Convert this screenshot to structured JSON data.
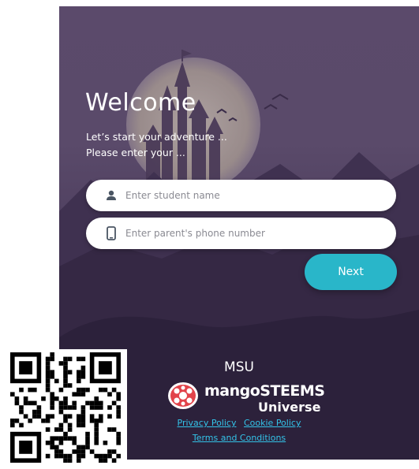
{
  "welcome": {
    "title": "Welcome",
    "subtitle_line1": "Let’s start your adventure ...",
    "subtitle_line2": "Please enter your ..."
  },
  "form": {
    "student_placeholder": "Enter student name",
    "phone_placeholder": "Enter parent's phone number",
    "next_label": "Next"
  },
  "footer": {
    "msu": "MSU",
    "logo_brand": "mangoSTEEMS",
    "logo_sub": "Universe",
    "privacy": "Privacy Policy",
    "cookie": "Cookie Policy",
    "terms": "Terms and Conditions"
  },
  "colors": {
    "accent": "#29b6c9",
    "link": "#33c3e8",
    "panel": "#5a4a6a",
    "logo_red": "#e2434a"
  },
  "icons": [
    "person-icon",
    "phone-icon",
    "mangosteen-logo-icon",
    "qr-code"
  ]
}
